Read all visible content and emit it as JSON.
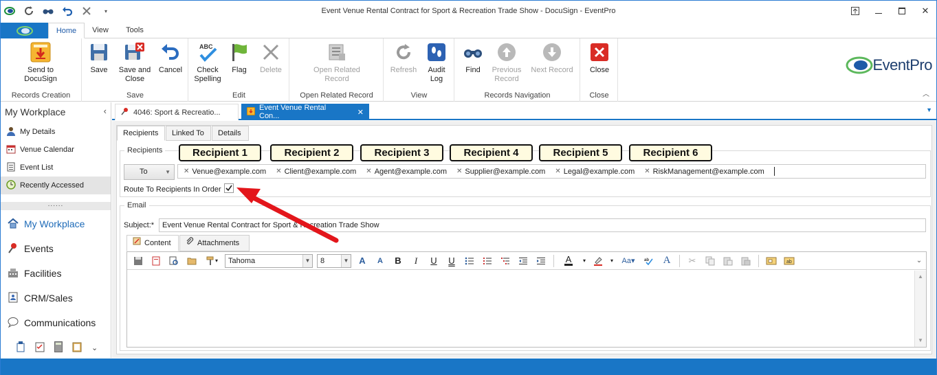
{
  "window": {
    "title": "Event Venue Rental Contract for Sport & Recreation Trade Show - DocuSign - EventPro",
    "controls": [
      "restore-to-top",
      "minimize",
      "maximize",
      "close"
    ]
  },
  "ribbon_tabs": [
    {
      "label": "Home",
      "active": true
    },
    {
      "label": "View",
      "active": false
    },
    {
      "label": "Tools",
      "active": false
    }
  ],
  "ribbon": {
    "groups": {
      "records_creation": "Records Creation",
      "save": "Save",
      "edit": "Edit",
      "open_related_record": "Open Related Record",
      "view": "View",
      "records_navigation": "Records Navigation",
      "close": "Close"
    },
    "buttons": {
      "send_to_docusign": "Send to\nDocuSign",
      "save": "Save",
      "save_and_close": "Save and\nClose",
      "cancel": "Cancel",
      "check_spelling": "Check\nSpelling",
      "flag": "Flag",
      "delete": "Delete",
      "open_related_record": "Open Related\nRecord",
      "refresh": "Refresh",
      "audit_log": "Audit\nLog",
      "find": "Find",
      "previous_record": "Previous\nRecord",
      "next_record": "Next Record",
      "close": "Close"
    },
    "logo_text": "EventPro"
  },
  "sidebar": {
    "title": "My Workplace",
    "items": [
      {
        "label": "My Details",
        "icon": "person-icon"
      },
      {
        "label": "Venue Calendar",
        "icon": "calendar-icon"
      },
      {
        "label": "Event List",
        "icon": "list-icon"
      },
      {
        "label": "Recently Accessed",
        "icon": "clock-icon",
        "active": true
      }
    ],
    "splitter": "......",
    "nav": [
      {
        "label": "My Workplace",
        "icon": "house-icon",
        "selected": true
      },
      {
        "label": "Events",
        "icon": "pushpin-icon"
      },
      {
        "label": "Facilities",
        "icon": "building-icon"
      },
      {
        "label": "CRM/Sales",
        "icon": "address-book-icon"
      },
      {
        "label": "Communications",
        "icon": "speech-bubble-icon"
      }
    ]
  },
  "doc_tabs": [
    {
      "label": "4046: Sport & Recreatio...",
      "active": false
    },
    {
      "label": "Event Venue Rental Con...",
      "active": true
    }
  ],
  "form": {
    "tabs": [
      "Recipients",
      "Linked To",
      "Details"
    ],
    "recipients_legend": "Recipients",
    "to_button": "To",
    "recipients": [
      "Venue@example.com",
      "Client@example.com",
      "Agent@example.com",
      "Supplier@example.com",
      "Legal@example.com",
      "RiskManagement@example.com"
    ],
    "route_label": "Route To Recipients In Order",
    "route_checked": true,
    "callouts": [
      "Recipient 1",
      "Recipient 2",
      "Recipient 3",
      "Recipient 4",
      "Recipient 5",
      "Recipient 6"
    ],
    "email_legend": "Email",
    "subject_label": "Subject:*",
    "subject_value": "Event Venue Rental Contract for Sport & Recreation Trade Show",
    "email_tabs": [
      "Content",
      "Attachments"
    ],
    "font_name": "Tahoma",
    "font_size": "8"
  },
  "colors": {
    "accent": "#1976c6",
    "callout_bg": "#fffbe0",
    "arrow": "#e3161b"
  }
}
